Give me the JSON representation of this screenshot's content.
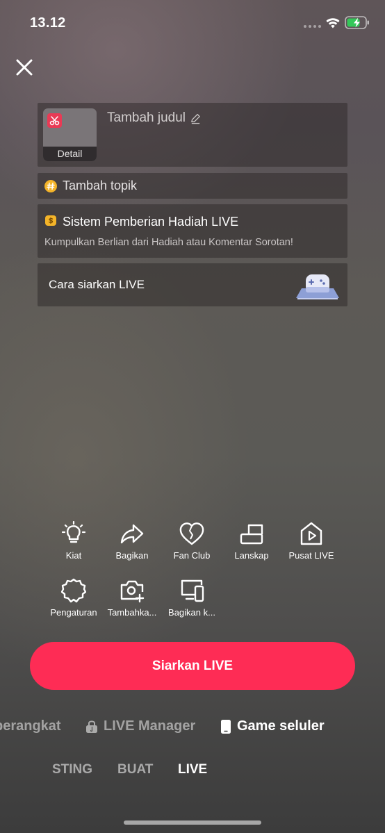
{
  "status_bar": {
    "time": "13.12"
  },
  "setup": {
    "thumbnail_label": "Detail",
    "title_placeholder": "Tambah judul",
    "topic_label": "Tambah topik",
    "gift_title": "Sistem Pemberian Hadiah LIVE",
    "gift_subtitle": "Kumpulkan Berlian dari Hadiah atau Komentar Sorotan!",
    "how_to_label": "Cara siarkan LIVE"
  },
  "tools": [
    {
      "label": "Kiat",
      "icon": "lightbulb-icon"
    },
    {
      "label": "Bagikan",
      "icon": "share-icon"
    },
    {
      "label": "Fan Club",
      "icon": "heart-icon"
    },
    {
      "label": "Lanskap",
      "icon": "landscape-icon"
    },
    {
      "label": "Pusat LIVE",
      "icon": "live-center-icon"
    },
    {
      "label": "Pengaturan",
      "icon": "settings-icon"
    },
    {
      "label": "Tambahka...",
      "icon": "add-camera-icon"
    },
    {
      "label": "Bagikan k...",
      "icon": "share-device-icon"
    }
  ],
  "go_live_label": "Siarkan LIVE",
  "modes": [
    {
      "label": "perangkat",
      "active": false
    },
    {
      "label": "LIVE Manager",
      "active": false
    },
    {
      "label": "Game seluler",
      "active": true
    }
  ],
  "tabs": [
    {
      "label": "STING",
      "active": false
    },
    {
      "label": "BUAT",
      "active": false
    },
    {
      "label": "LIVE",
      "active": true
    }
  ],
  "colors": {
    "accent": "#fe2c55",
    "topic_icon": "#f4b429",
    "thumb_badge": "#e93a55"
  }
}
